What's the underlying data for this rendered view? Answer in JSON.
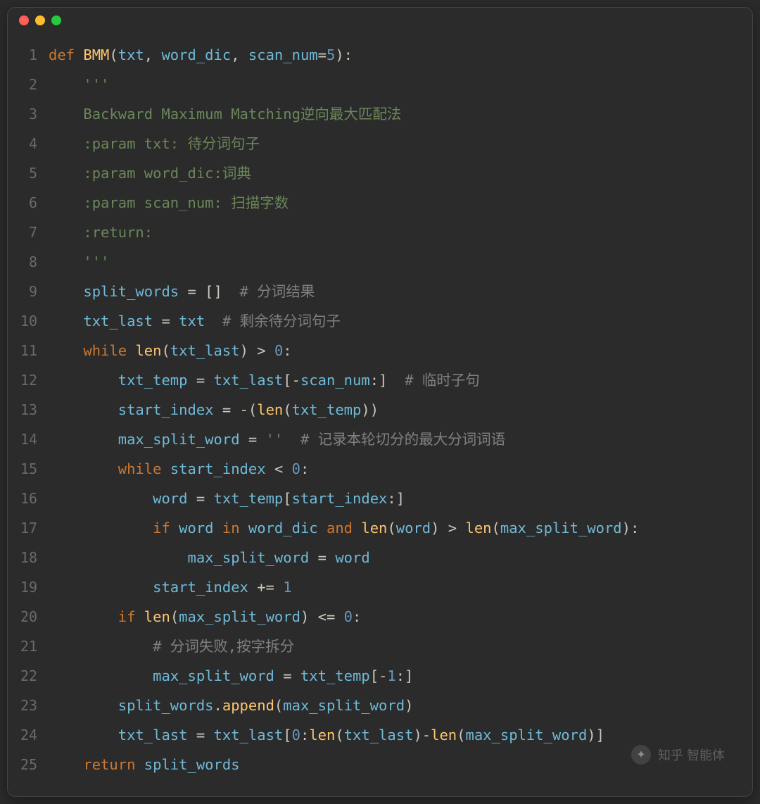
{
  "window": {
    "dots": [
      "red",
      "yellow",
      "green"
    ]
  },
  "gutter": [
    "1",
    "2",
    "3",
    "4",
    "5",
    "6",
    "7",
    "8",
    "9",
    "10",
    "11",
    "12",
    "13",
    "14",
    "15",
    "16",
    "17",
    "18",
    "19",
    "20",
    "21",
    "22",
    "23",
    "24",
    "25"
  ],
  "code": {
    "l1": {
      "def": "def ",
      "fn": "BMM",
      "p1": "(",
      "a1": "txt",
      "c1": ", ",
      "a2": "word_dic",
      "c2": ", ",
      "a3": "scan_num",
      "eq": "=",
      "n": "5",
      "p2": "):"
    },
    "l2": {
      "indent": "    ",
      "s": "'''"
    },
    "l3": {
      "indent": "    ",
      "s": "Backward Maximum Matching逆向最大匹配法"
    },
    "l4": {
      "indent": "    ",
      "s": ":param txt: 待分词句子"
    },
    "l5": {
      "indent": "    ",
      "s": ":param word_dic:词典"
    },
    "l6": {
      "indent": "    ",
      "s": ":param scan_num: 扫描字数"
    },
    "l7": {
      "indent": "    ",
      "s": ":return:"
    },
    "l8": {
      "indent": "    ",
      "s": "'''"
    },
    "l9": {
      "indent": "    ",
      "v": "split_words",
      "eq": " = ",
      "b": "[]",
      "sp": "  ",
      "cmt": "# 分词结果"
    },
    "l10": {
      "indent": "    ",
      "v": "txt_last",
      "eq": " = ",
      "v2": "txt",
      "sp": "  ",
      "cmt": "# 剩余待分词句子"
    },
    "l11": {
      "indent": "    ",
      "kw": "while ",
      "fn": "len",
      "p1": "(",
      "a": "txt_last",
      "p2": ") > ",
      "n": "0",
      "p3": ":"
    },
    "l12": {
      "indent": "        ",
      "v": "txt_temp",
      "eq": " = ",
      "v2": "txt_last",
      "b1": "[-",
      "a": "scan_num",
      "b2": ":]",
      "sp": "  ",
      "cmt": "# 临时子句"
    },
    "l13": {
      "indent": "        ",
      "v": "start_index",
      "eq": " = -(",
      "fn": "len",
      "p1": "(",
      "a": "txt_temp",
      "p2": "))"
    },
    "l14": {
      "indent": "        ",
      "v": "max_split_word",
      "eq": " = ",
      "s": "''",
      "sp": "  ",
      "cmt": "# 记录本轮切分的最大分词词语"
    },
    "l15": {
      "indent": "        ",
      "kw": "while ",
      "v": "start_index",
      "op": " < ",
      "n": "0",
      "p": ":"
    },
    "l16": {
      "indent": "            ",
      "v": "word",
      "eq": " = ",
      "v2": "txt_temp",
      "b1": "[",
      "a": "start_index",
      "b2": ":]"
    },
    "l17": {
      "indent": "            ",
      "kw1": "if ",
      "v1": "word",
      "kw2": " in ",
      "v2": "word_dic",
      "kw3": " and ",
      "fn": "len",
      "p1": "(",
      "a1": "word",
      "p2": ") > ",
      "fn2": "len",
      "p3": "(",
      "a2": "max_split_word",
      "p4": "):"
    },
    "l18": {
      "indent": "                ",
      "v": "max_split_word",
      "eq": " = ",
      "v2": "word"
    },
    "l19": {
      "indent": "            ",
      "v": "start_index",
      "op": " += ",
      "n": "1"
    },
    "l20": {
      "indent": "        ",
      "kw": "if ",
      "fn": "len",
      "p1": "(",
      "a": "max_split_word",
      "p2": ") <= ",
      "n": "0",
      "p3": ":"
    },
    "l21": {
      "indent": "            ",
      "cmt": "# 分词失败,按字拆分"
    },
    "l22": {
      "indent": "            ",
      "v": "max_split_word",
      "eq": " = ",
      "v2": "txt_temp",
      "b1": "[-",
      "n": "1",
      "b2": ":]"
    },
    "l23": {
      "indent": "        ",
      "v": "split_words",
      "dot": ".",
      "fn": "append",
      "p1": "(",
      "a": "max_split_word",
      "p2": ")"
    },
    "l24": {
      "indent": "        ",
      "v": "txt_last",
      "eq": " = ",
      "v2": "txt_last",
      "b1": "[",
      "n1": "0",
      "c": ":",
      "fn": "len",
      "p1": "(",
      "a1": "txt_last",
      "p2": ")-",
      "fn2": "len",
      "p3": "(",
      "a2": "max_split_word",
      "p4": ")]"
    },
    "l25": {
      "indent": "    ",
      "kw": "return ",
      "v": "split_words"
    }
  },
  "watermark": {
    "text": "知乎 智能体"
  }
}
